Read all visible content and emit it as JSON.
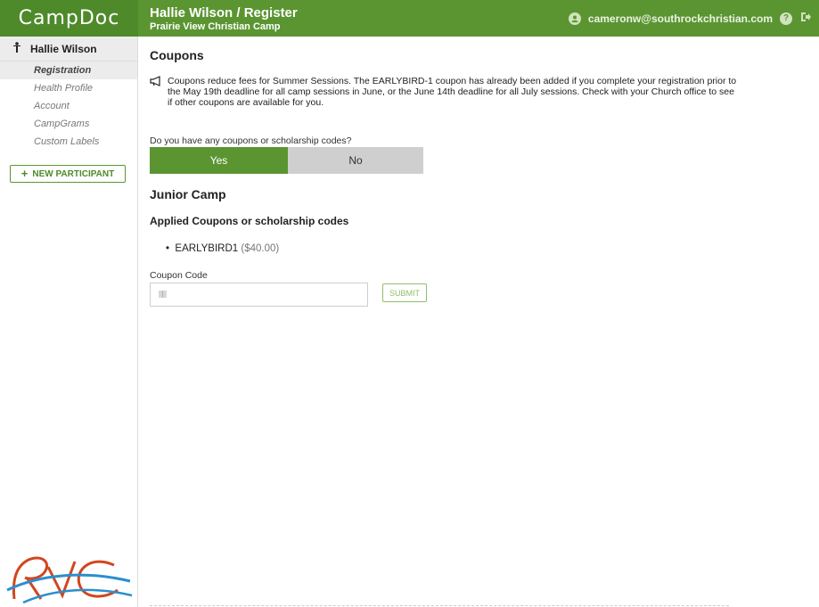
{
  "app": {
    "brand": "CampDoc"
  },
  "header": {
    "title": "Hallie Wilson / Register",
    "subtitle": "Prairie View Christian Camp",
    "user_email": "cameronw@southrockchristian.com"
  },
  "sidebar": {
    "participant_name": "Hallie Wilson",
    "items": [
      {
        "label": "Registration",
        "active": true
      },
      {
        "label": "Health Profile",
        "active": false
      },
      {
        "label": "Account",
        "active": false
      },
      {
        "label": "CampGrams",
        "active": false
      },
      {
        "label": "Custom Labels",
        "active": false
      }
    ],
    "new_participant_label": "NEW PARTICIPANT"
  },
  "coupons": {
    "heading": "Coupons",
    "notice": "Coupons reduce fees for Summer Sessions. The EARLYBIRD-1 coupon has already been added if you complete your registration prior to the May 19th deadline for all camp sessions in June, or the June 14th deadline for all July sessions. Check with your Church office to see if other coupons are available for you.",
    "question": "Do you have any coupons or scholarship codes?",
    "yes_label": "Yes",
    "no_label": "No",
    "selected": "Yes"
  },
  "session": {
    "heading": "Junior Camp",
    "applied_heading": "Applied Coupons or scholarship codes",
    "applied": [
      {
        "code": "EARLYBIRD1",
        "amount": "($40.00)"
      }
    ],
    "coupon_code_label": "Coupon Code",
    "coupon_code_value": "",
    "submit_label": "SUBMIT"
  },
  "colors": {
    "brand_green": "#5b9532",
    "toggle_off": "#cfcfcf"
  }
}
